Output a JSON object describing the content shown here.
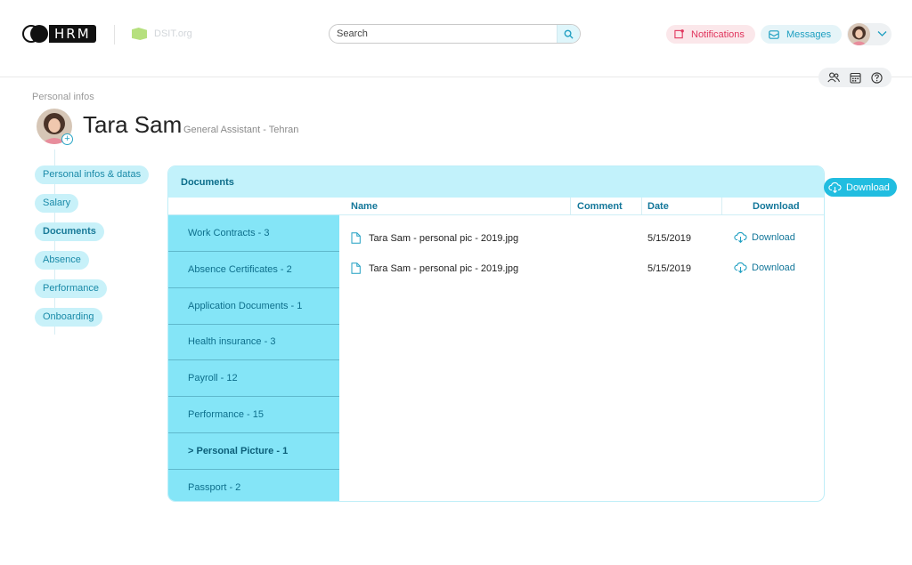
{
  "header": {
    "logo_text": "HRM",
    "org_label": "DSIT.org",
    "search_placeholder": "Search",
    "notifications_label": "Notifications",
    "messages_label": "Messages"
  },
  "colors": {
    "accent": "#21bde0",
    "notifications": "#e0355d",
    "category_bg": "#84e5f7",
    "panel_header_bg": "#c2f2fb"
  },
  "profile": {
    "section_title": "Personal infos",
    "name": "Tara Sam",
    "role": "General Assistant - Tehran"
  },
  "sidebar": {
    "items": [
      {
        "label": "Personal infos & datas"
      },
      {
        "label": "Salary"
      },
      {
        "label": "Documents"
      },
      {
        "label": "Absence"
      },
      {
        "label": "Performance"
      },
      {
        "label": "Onboarding"
      }
    ],
    "active": "Documents"
  },
  "documents": {
    "title": "Documents",
    "categories": [
      {
        "label": "Work Contracts - 3"
      },
      {
        "label": "Absence Certificates - 2"
      },
      {
        "label": "Application Documents - 1"
      },
      {
        "label": "Health insurance - 3"
      },
      {
        "label": "Payroll - 12"
      },
      {
        "label": "Performance - 15"
      },
      {
        "label": "> Personal Picture - 1"
      },
      {
        "label": "Passport - 2"
      }
    ],
    "columns": {
      "name": "Name",
      "comment": "Comment",
      "date": "Date",
      "download": "Download"
    },
    "files": [
      {
        "name": "Tara Sam - personal pic - 2019.jpg",
        "date": "5/15/2019",
        "action": "Download"
      },
      {
        "name": "Tara Sam - personal pic - 2019.jpg",
        "date": "5/15/2019",
        "action": "Download"
      }
    ]
  },
  "float_download_label": "Download",
  "icons": [
    "bell-icon",
    "envelope-icon",
    "search-icon",
    "chevron-down-icon",
    "team-icon",
    "calendar-icon",
    "help-icon",
    "file-icon",
    "cloud-download-icon",
    "add-photo-icon"
  ]
}
